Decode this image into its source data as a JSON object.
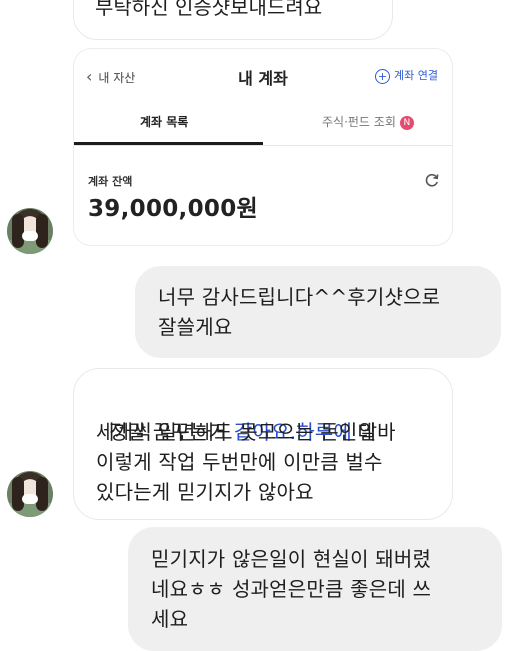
{
  "chat": {
    "top_partial": "부탁하신 인증샷보내드려요",
    "bank": {
      "back_label": "내 자산",
      "title": "내 계좌",
      "link_label": "계좌 연결",
      "tab_active": "계좌 목록",
      "tab_inactive": "주식·펀드 조회",
      "tab_badge": "N",
      "balance_label": "계좌 잔액",
      "balance_value": "39,000,000원"
    },
    "out1": {
      "line1": "너무 감사드립니다^^후기샷으로",
      "line2": "잘쓸게요"
    },
    "in2": {
      "line1_a": "정말 꿈꾸는거 ",
      "line1_b": "같아요.하루에",
      "line1_c": " 알바",
      "line2": "세개씩 일년해도 못모으는 돈인데",
      "line3": "이렇게 작업 두번만에 이만큼 벌수",
      "line4": "있다는게 믿기지가 않아요"
    },
    "out2": {
      "line1": "믿기지가 않은일이 현실이 돼버렸",
      "line2": "네요ㅎㅎ 성과얻은만큼 좋은데 쓰",
      "line3": "세요"
    }
  },
  "colors": {
    "incoming_bg": "#ffffff",
    "outgoing_bg": "#efefef",
    "link_blue": "#2a4fc9",
    "bank_accent": "#2f5bd3",
    "badge_red": "#e54a6f"
  }
}
